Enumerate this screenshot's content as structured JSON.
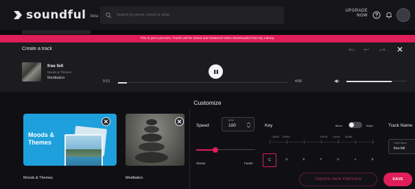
{
  "app": {
    "brand": "soundful",
    "brand_tag": "beta",
    "search_placeholder": "Search by genre, mood or artist",
    "upgrade_line1": "UPGRADE",
    "upgrade_line2": "NOW",
    "accent_color": "#e01e5a"
  },
  "banner": {
    "text": "This is just a preview. Tracks will be mixed and mastered when downloaded from My Library."
  },
  "panel": {
    "title": "Create a track"
  },
  "player": {
    "track_name": "free fell",
    "category": "Moods & Themes",
    "subcategory": "Meditation",
    "time_current": "0:13",
    "time_total": "4:00",
    "progress_fraction": 0.054,
    "volume_fraction": 0.75
  },
  "customize": {
    "title": "Customize",
    "cards": [
      {
        "overlay_line1": "Moods &",
        "overlay_line2": "Themes",
        "label": "Moods & Themes"
      },
      {
        "label": "Meditation"
      }
    ],
    "speed": {
      "label": "Speed",
      "unit": "BPM",
      "value": "100",
      "min_label": "Slower",
      "max_label": "Faster",
      "slider_fraction": 0.33
    },
    "key": {
      "label": "Key",
      "minor_label": "Minor",
      "major_label": "Major",
      "mode": "Minor",
      "sharps": [
        "C#/Db",
        "D#/Eb",
        "F#/Gb",
        "G#/Ab",
        "A#/Bb"
      ],
      "naturals": [
        "C",
        "D",
        "E",
        "F",
        "G",
        "A",
        "B"
      ],
      "selected": "C"
    },
    "track_name": {
      "label": "Track Name",
      "field_caption": "Track Name",
      "value": "free fell"
    }
  },
  "actions": {
    "preview": "CREATE NEW PREVIEW",
    "save": "SAVE"
  }
}
